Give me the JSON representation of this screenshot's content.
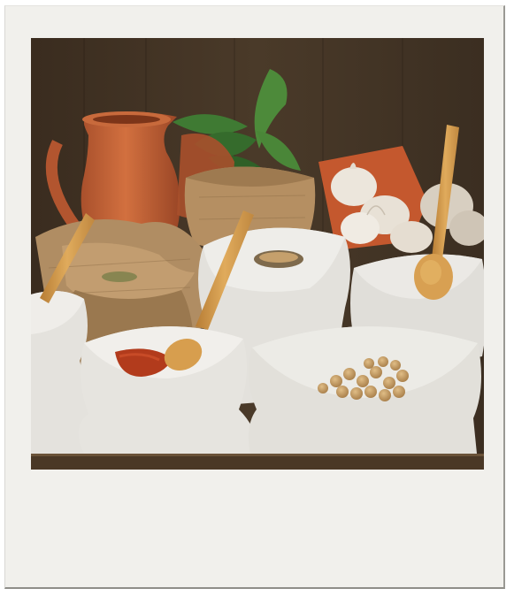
{
  "photo": {
    "subject": "spice-market-still-life",
    "colors": {
      "frame": "#f1f0ec",
      "background_wood": "#3f3123",
      "terracotta": "#c6643a",
      "burlap": "#b08d63",
      "cotton_sack": "#e2e0db",
      "wooden_spoon": "#d49a4c",
      "paprika": "#b23b1c",
      "chickpea": "#c8a06a",
      "basil": "#3f7a33",
      "shelf": "#4a3826"
    },
    "elements": [
      "terracotta-jug",
      "basil-leaves",
      "garlic-bulbs",
      "burlap-sack",
      "cotton-sack",
      "wooden-spoon",
      "paprika-powder",
      "chickpeas",
      "wooden-shelf"
    ]
  }
}
